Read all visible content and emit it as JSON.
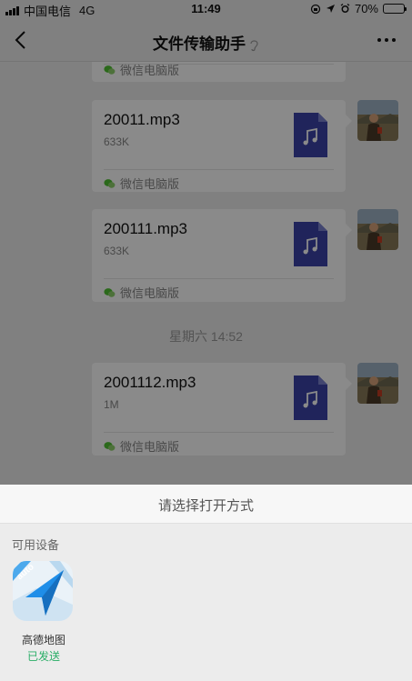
{
  "status_bar": {
    "carrier": "中国电信",
    "network": "4G",
    "time": "11:49",
    "battery": "70%",
    "battery_level": 0.7
  },
  "nav": {
    "title": "文件传输助手"
  },
  "messages": [
    {
      "footer": "微信电脑版"
    },
    {
      "file_name": "20011.mp3",
      "size": "633K",
      "footer": "微信电脑版"
    },
    {
      "file_name": "200111.mp3",
      "size": "633K",
      "footer": "微信电脑版"
    },
    {
      "file_name": "2001112.mp3",
      "size": "1M",
      "footer": "微信电脑版"
    }
  ],
  "time_separator": "星期六 14:52",
  "sheet": {
    "title": "请选择打开方式",
    "section_label": "可用设备",
    "app": {
      "badge": "auto",
      "name": "高德地图",
      "status": "已发送"
    }
  },
  "colors": {
    "file_icon": "#3b44a8",
    "sent_status": "#2aae67",
    "overlay": "rgba(0,0,0,0.46)"
  }
}
